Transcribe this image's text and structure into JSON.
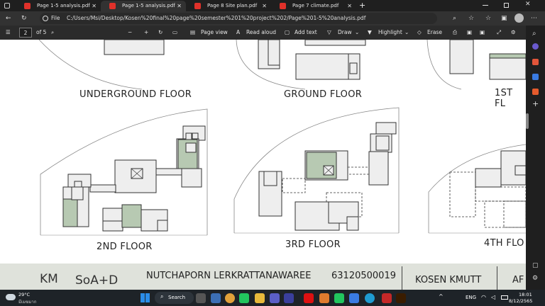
{
  "tabs": [
    {
      "label": "Page 1-5 analysis.pdf",
      "close": "✕"
    },
    {
      "label": "Page 1-5 analysis.pdf",
      "close": "✕"
    },
    {
      "label": "Page 8 Site plan.pdf",
      "close": "✕"
    },
    {
      "label": "Page 7 climate.pdf",
      "close": "✕"
    }
  ],
  "new_tab": "+",
  "address": {
    "prefix": "File",
    "url": "C:/Users/Msi/Desktop/Kosen%20final%20page%20semester%201%20project%202/Page%201-5%20analysis.pdf"
  },
  "pdf_toolbar": {
    "page_current": "2",
    "page_total": "of 5",
    "page_view": "Page view",
    "read_aloud": "Read aloud",
    "add_text": "Add text",
    "draw": "Draw",
    "highlight": "Highlight",
    "erase": "Erase"
  },
  "floors": {
    "underground": "UNDERGROUND FLOOR",
    "ground": "GROUND FLOOR",
    "first": "1ST FL",
    "second": "2ND FLOOR",
    "third": "3RD FLOOR",
    "fourth": "4TH FLO"
  },
  "title_block": {
    "logo": "KM",
    "logo2": "SoA+D",
    "name": "NUTCHAPORN LERKRATTANAWAREE",
    "id": "63120500019",
    "school": "KOSEN KMUTT",
    "extra": "AF"
  },
  "taskbar": {
    "temp": "29°C",
    "weather": "มีเมฆมาก",
    "search": "Search",
    "lang": "ENG",
    "time": "18:01",
    "date": "8/12/2565"
  }
}
